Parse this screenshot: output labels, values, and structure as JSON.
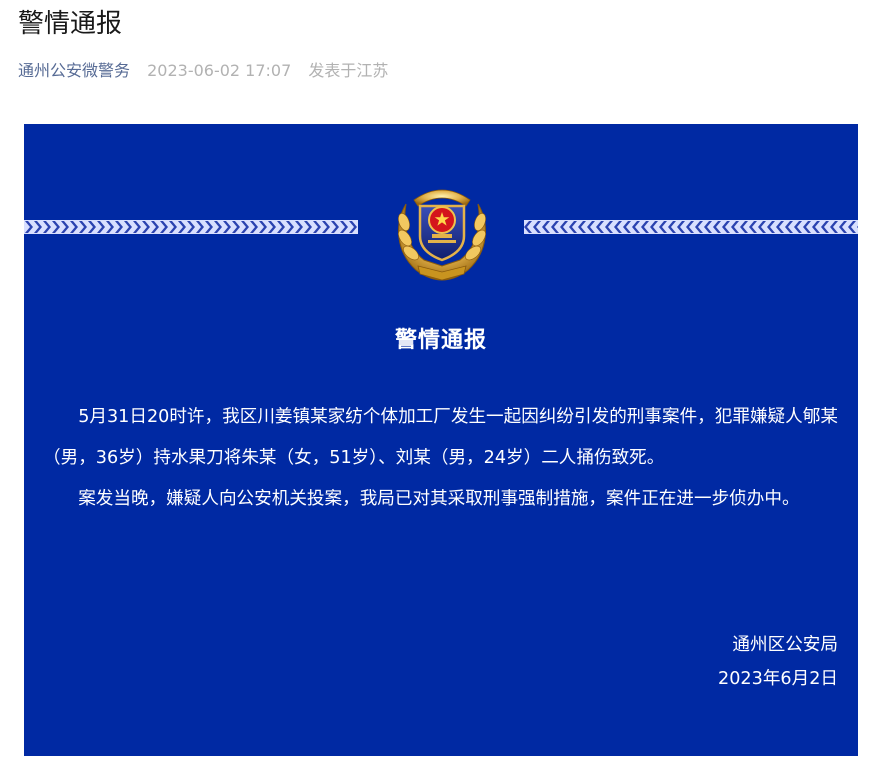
{
  "article": {
    "title": "警情通报",
    "account": "通州公安微警务",
    "datetime": "2023-06-02 17:07",
    "location": "发表于江苏"
  },
  "notice": {
    "background_color": "#0029a3",
    "emblem_icon": "police-emblem-icon",
    "heading": "警情通报",
    "paragraphs": [
      "5月31日20时许，我区川姜镇某家纺个体加工厂发生一起因纠纷引发的刑事案件，犯罪嫌疑人郇某（男，36岁）持水果刀将朱某（女，51岁）、刘某（男，24岁）二人捅伤致死。",
      "案发当晚，嫌疑人向公安机关投案，我局已对其采取刑事强制措施，案件正在进一步侦办中。"
    ],
    "signature": "通州区公安局",
    "date": "2023年6月2日"
  }
}
